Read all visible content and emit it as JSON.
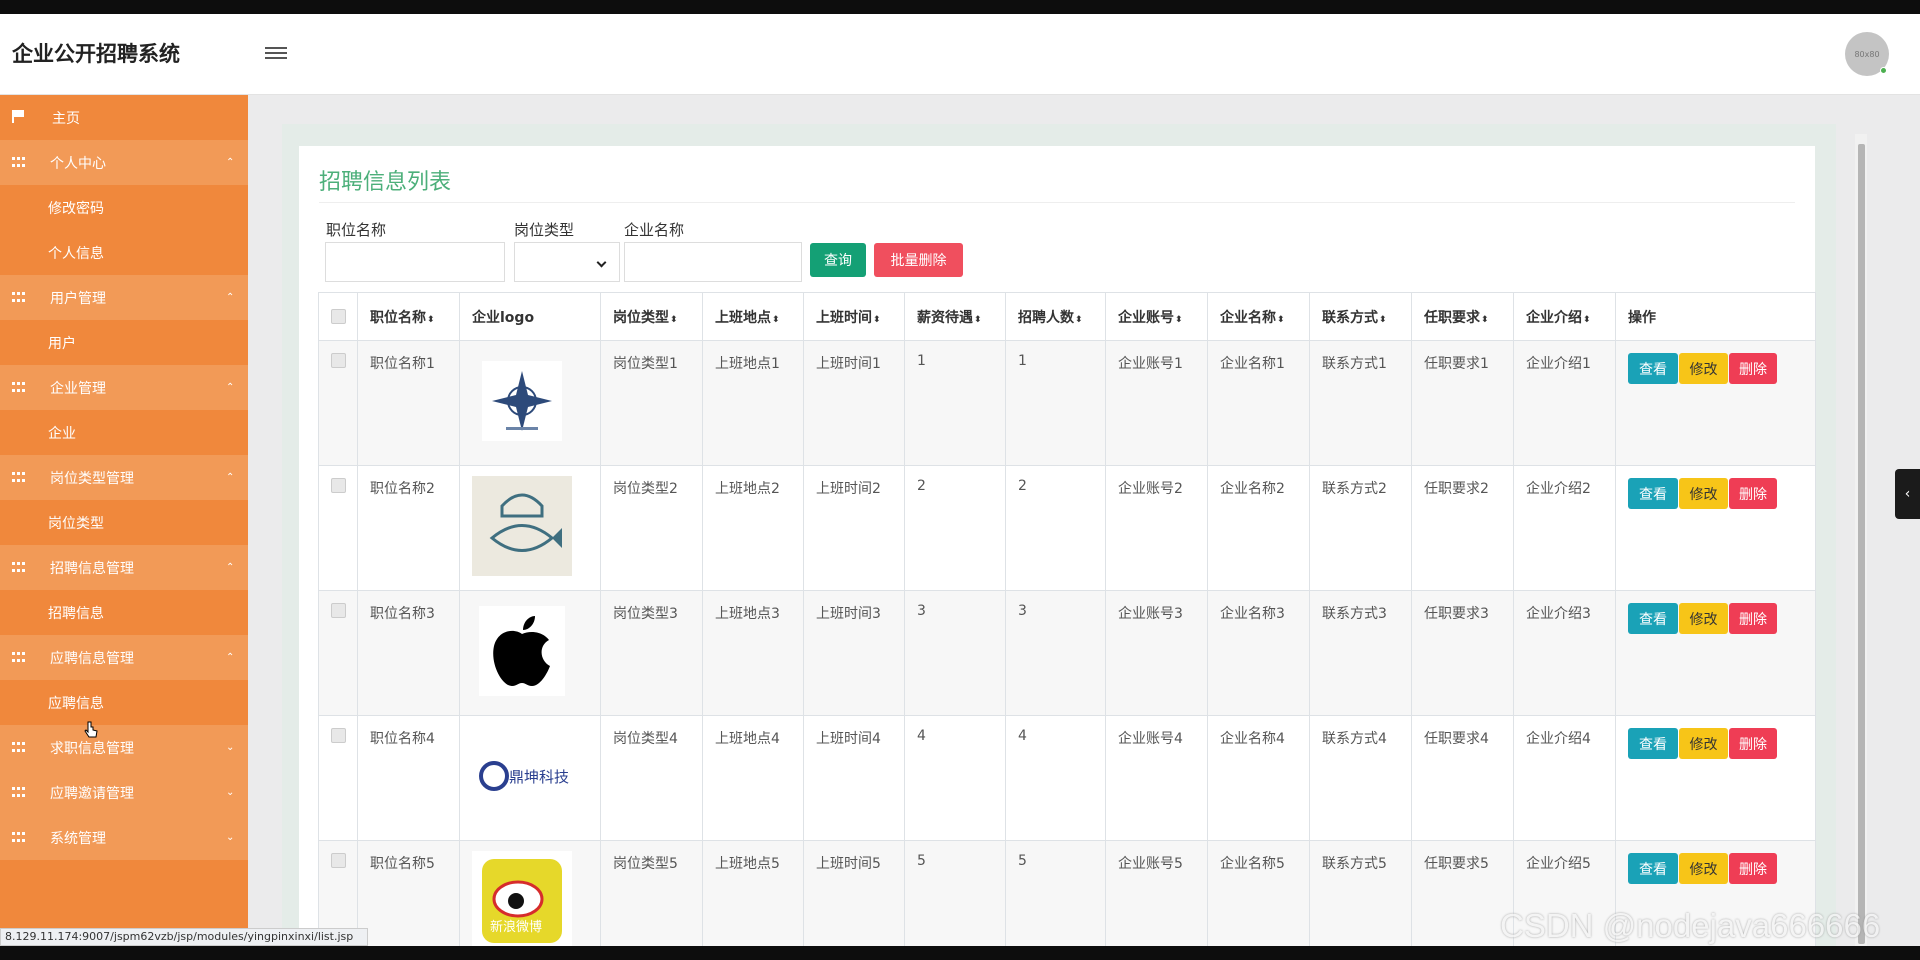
{
  "app": {
    "title": "企业公开招聘系统",
    "avatar_text": "80x80"
  },
  "sidebar": {
    "items": [
      {
        "label": "主页",
        "type": "home"
      },
      {
        "label": "个人中心",
        "type": "parent",
        "caret": "⌃"
      },
      {
        "label": "修改密码",
        "type": "child"
      },
      {
        "label": "个人信息",
        "type": "child"
      },
      {
        "label": "用户管理",
        "type": "parent",
        "caret": "⌃"
      },
      {
        "label": "用户",
        "type": "child"
      },
      {
        "label": "企业管理",
        "type": "parent",
        "caret": "⌃"
      },
      {
        "label": "企业",
        "type": "child"
      },
      {
        "label": "岗位类型管理",
        "type": "parent",
        "caret": "⌃"
      },
      {
        "label": "岗位类型",
        "type": "child"
      },
      {
        "label": "招聘信息管理",
        "type": "parent",
        "caret": "⌃"
      },
      {
        "label": "招聘信息",
        "type": "child"
      },
      {
        "label": "应聘信息管理",
        "type": "parent",
        "caret": "⌃"
      },
      {
        "label": "应聘信息",
        "type": "child"
      },
      {
        "label": "求职信息管理",
        "type": "parent",
        "caret": "⌄"
      },
      {
        "label": "应聘邀请管理",
        "type": "parent",
        "caret": "⌄"
      },
      {
        "label": "系统管理",
        "type": "parent",
        "caret": "⌄"
      }
    ]
  },
  "page": {
    "title": "招聘信息列表",
    "filters": {
      "position_label": "职位名称",
      "type_label": "岗位类型",
      "company_label": "企业名称"
    },
    "buttons": {
      "search": "查询",
      "batch_delete": "批量删除"
    }
  },
  "table": {
    "columns": [
      "职位名称",
      "企业logo",
      "岗位类型",
      "上班地点",
      "上班时间",
      "薪资待遇",
      "招聘人数",
      "企业账号",
      "企业名称",
      "联系方式",
      "任职要求",
      "企业介绍",
      "操作"
    ],
    "sortable": [
      true,
      false,
      true,
      true,
      true,
      true,
      true,
      true,
      true,
      true,
      true,
      true,
      false
    ],
    "rows": [
      {
        "position": "职位名称1",
        "logo": "compass-logo",
        "type": "岗位类型1",
        "location": "上班地点1",
        "time": "上班时间1",
        "salary": "1",
        "count": "1",
        "account": "企业账号1",
        "company": "企业名称1",
        "contact": "联系方式1",
        "requirement": "任职要求1",
        "intro": "企业介绍1"
      },
      {
        "position": "职位名称2",
        "logo": "chef-fish-logo",
        "type": "岗位类型2",
        "location": "上班地点2",
        "time": "上班时间2",
        "salary": "2",
        "count": "2",
        "account": "企业账号2",
        "company": "企业名称2",
        "contact": "联系方式2",
        "requirement": "任职要求2",
        "intro": "企业介绍2"
      },
      {
        "position": "职位名称3",
        "logo": "apple-logo",
        "type": "岗位类型3",
        "location": "上班地点3",
        "time": "上班时间3",
        "salary": "3",
        "count": "3",
        "account": "企业账号3",
        "company": "企业名称3",
        "contact": "联系方式3",
        "requirement": "任职要求3",
        "intro": "企业介绍3"
      },
      {
        "position": "职位名称4",
        "logo": "tech-logo",
        "type": "岗位类型4",
        "location": "上班地点4",
        "time": "上班时间4",
        "salary": "4",
        "count": "4",
        "account": "企业账号4",
        "company": "企业名称4",
        "contact": "联系方式4",
        "requirement": "任职要求4",
        "intro": "企业介绍4"
      },
      {
        "position": "职位名称5",
        "logo": "weibo-logo",
        "type": "岗位类型5",
        "location": "上班地点5",
        "time": "上班时间5",
        "salary": "5",
        "count": "5",
        "account": "企业账号5",
        "company": "企业名称5",
        "contact": "联系方式5",
        "requirement": "任职要求5",
        "intro": "企业介绍5"
      }
    ],
    "actions": {
      "view": "查看",
      "edit": "修改",
      "delete": "删除"
    }
  },
  "logo_texts": {
    "tech": "鼎坤科技",
    "weibo": "新浪微博"
  },
  "statusbar": "8.129.11.174:9007/jspm62vzb/jsp/modules/yingpinxinxi/list.jsp",
  "watermark": "CSDN @nodejava666666",
  "colors": {
    "sidebar": "#f0883c",
    "sidebar_parent": "#f29a57",
    "accent_green": "#4caf7a",
    "search_btn": "#14a075",
    "delete_btn": "#f04f5e",
    "view_btn": "#1aa2b7",
    "edit_btn": "#f7c518"
  }
}
